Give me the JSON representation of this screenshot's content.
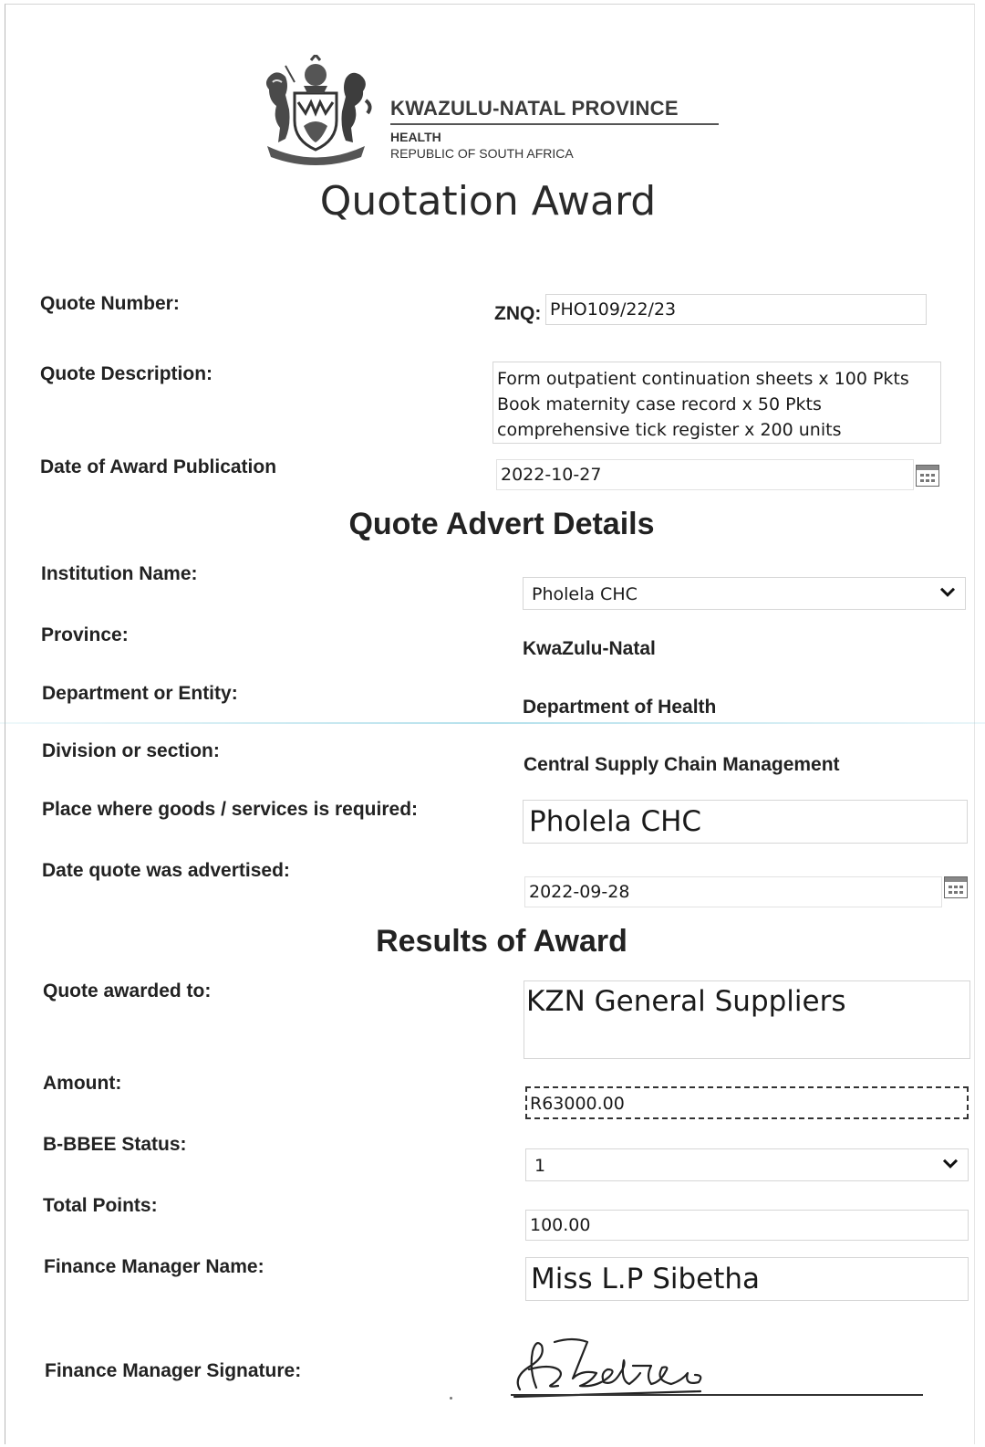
{
  "header": {
    "org_name": "KWAZULU-NATAL PROVINCE",
    "dept": "HEALTH",
    "country": "REPUBLIC OF SOUTH AFRICA",
    "title": "Quotation Award"
  },
  "quote": {
    "number_label": "Quote Number:",
    "number_prefix": "ZNQ:",
    "number_value": "PHO109/22/23",
    "description_label": "Quote Description:",
    "description_lines": [
      "Form outpatient continuation sheets x 100 Pkts",
      "Book maternity case record x 50 Pkts",
      "comprehensive tick register x 200 units"
    ],
    "award_date_label": "Date of Award Publication",
    "award_date_value": "2022-10-27"
  },
  "advert": {
    "heading": "Quote Advert Details",
    "institution_label": "Institution Name:",
    "institution_value": "Pholela CHC",
    "province_label": "Province:",
    "province_value": "KwaZulu-Natal",
    "department_label": "Department or Entity:",
    "department_value": "Department of Health",
    "division_label": "Division or section:",
    "division_value": "Central Supply Chain Management",
    "place_label": "Place where goods /  services is required:",
    "place_value": "Pholela CHC",
    "advertised_label": "Date quote was advertised:",
    "advertised_value": "2022-09-28"
  },
  "results": {
    "heading": "Results of Award",
    "awarded_label": "Quote awarded to:",
    "awarded_value": "KZN General Suppliers",
    "amount_label": "Amount:",
    "amount_value": "R63000.00",
    "bbbee_label": "B-BBEE Status:",
    "bbbee_value": "1",
    "points_label": "Total Points:",
    "points_value": "100.00",
    "manager_label": "Finance Manager Name:",
    "manager_value": "Miss L.P Sibetha",
    "signature_label": "Finance Manager Signature:"
  },
  "icons": {
    "crest": "coat-of-arms-icon",
    "calendar": "calendar-icon",
    "dropdown": "chevron-down-icon"
  }
}
